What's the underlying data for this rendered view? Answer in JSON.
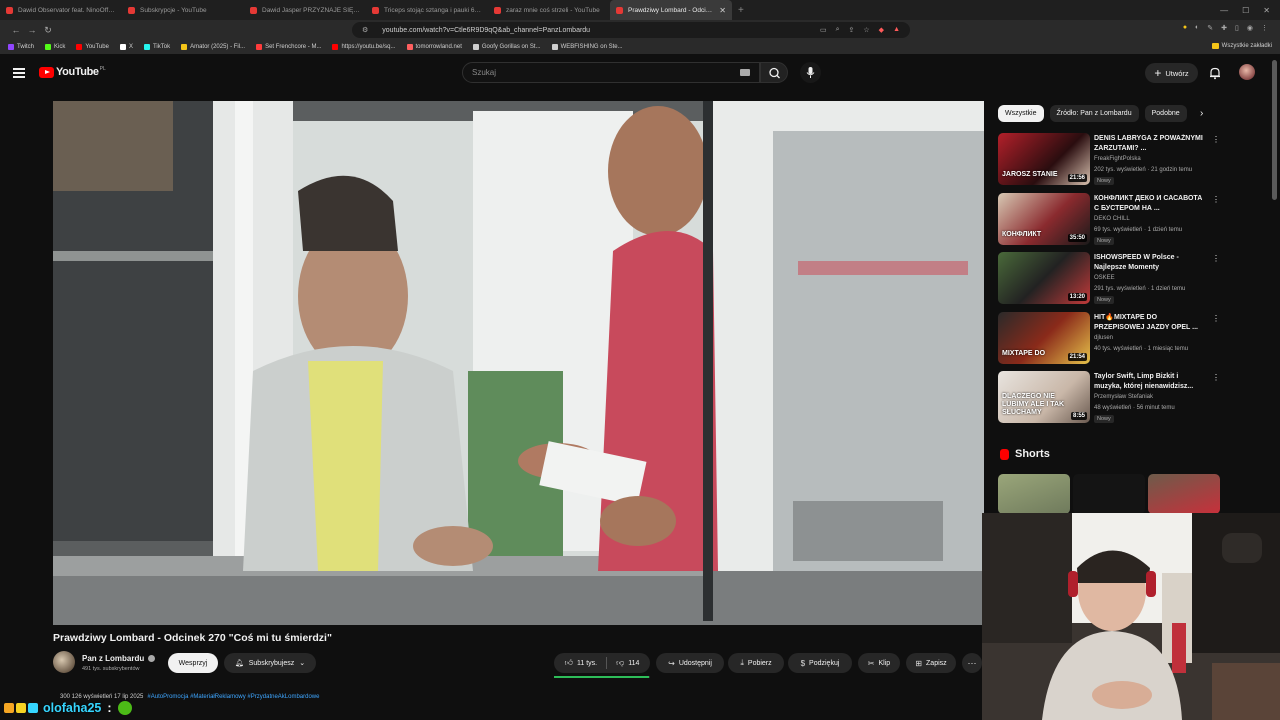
{
  "browser": {
    "tabs": [
      {
        "title": "Dawid Observator feat. NinoOfficjal",
        "active": false
      },
      {
        "title": "Subskrypcje - YouTube",
        "active": false
      },
      {
        "title": "Dawid Jasper PRZYZNAJE SIĘ DO B...",
        "active": false
      },
      {
        "title": "Triceps stojąc sztanga i pauki 6 x 3...",
        "active": false
      },
      {
        "title": "zaraz mnie coś strzeli - YouTube",
        "active": false
      },
      {
        "title": "Prawdziwy Lombard - Odcinek",
        "active": true
      }
    ],
    "url": "youtube.com/watch?v=Ctle6R9D9qQ&ab_channel=PanzLombardu",
    "bookmarks": [
      {
        "label": "Twitch",
        "color": "#9146ff"
      },
      {
        "label": "Kick",
        "color": "#53fc18"
      },
      {
        "label": "YouTube",
        "color": "#ff0000"
      },
      {
        "label": "X",
        "color": "#ffffff"
      },
      {
        "label": "TikTok",
        "color": "#25f4ee"
      },
      {
        "label": "Amator (2025) - Fil...",
        "color": "#f5c518"
      },
      {
        "label": "Set Frenchcore - M...",
        "color": "#ff3b3b"
      },
      {
        "label": "https://youtu.be/sq...",
        "color": "#ff0000"
      },
      {
        "label": "tomorrowland.net",
        "color": "#ff5f5f"
      },
      {
        "label": "Goofy Gorillas on St...",
        "color": "#cfcfcf"
      },
      {
        "label": "WEBFISHING on Ste...",
        "color": "#cfcfcf"
      }
    ],
    "bookmarks_all": "Wszystkie zakładki"
  },
  "header": {
    "logo_text": "YouTube",
    "logo_region": "PL",
    "search_placeholder": "Szukaj",
    "create_label": "Utwórz"
  },
  "video": {
    "title": "Prawdziwy Lombard - Odcinek 270 \"Coś mi tu śmierdzi\"",
    "channel": "Pan z Lombardu",
    "subscribers": "491 tys. subskrybentów",
    "support_label": "Wesprzyj",
    "subscribed_label": "Subskrybujesz",
    "likes": "11 tys.",
    "dislikes": "114",
    "like_ratio": 0.99,
    "share_label": "Udostępnij",
    "download_label": "Pobierz",
    "thanks_label": "Podziękuj",
    "clip_label": "Klip",
    "save_label": "Zapisz",
    "desc_peek": "300 126 wyświetleń  17 lip 2025",
    "desc_tags": "#AutoPromocja #MateriałReklamowy #PrzydatneAkLombardowe"
  },
  "sidebar": {
    "chips": [
      "Wszystkie",
      "Źródło: Pan z Lombardu",
      "Podobne"
    ],
    "recommendations": [
      {
        "title": "DENIS LABRYGA Z POWAŻNYMI ZARZUTAMI? ...",
        "channel": "FreakFightPolska",
        "meta": "202 tys. wyświetleń · 21 godzin temu",
        "badge": "Nowy",
        "duration": "21:56",
        "thumb_text": "JAROSZ  STANIE"
      },
      {
        "title": "КОНФЛИКТ ДЕКО И САСАВОТА С БУСТЕРОМ НА ...",
        "channel": "DEKO CHILL",
        "meta": "69 tys. wyświetleń · 1 dzień temu",
        "badge": "Nowy",
        "duration": "35:50",
        "thumb_text": "КОНФЛИКТ"
      },
      {
        "title": "ISHOWSPEED W Polsce - Najlepsze Momenty",
        "channel": "OSKEE",
        "meta": "291 tys. wyświetleń · 1 dzień temu",
        "badge": "Nowy",
        "duration": "13:20",
        "thumb_text": ""
      },
      {
        "title": "HIT🔥MIXTAPE DO PRZEPISOWEJ JAZDY OPEL ...",
        "channel": "djlusen",
        "meta": "40 tys. wyświetleń · 1 miesiąc temu",
        "badge": "",
        "duration": "21:54",
        "thumb_text": "MIXTAPE DO"
      },
      {
        "title": "Taylor Swift, Limp Bizkit i muzyka, której nienawidzisz...",
        "channel": "Przemysław Stefaniak",
        "meta": "48 wyświetleń · 56 minut temu",
        "badge": "Nowy",
        "duration": "8:55",
        "thumb_text": "DLACZEGO NIE LUBIMY ALE I TAK SŁUCHAMY"
      }
    ],
    "shorts_label": "Shorts"
  },
  "chat": {
    "username": "olofaha25",
    "colon": ":"
  },
  "colors": {
    "accent_red": "#ff0000",
    "like_bar": "#2ebd59",
    "chat_user": "#36d6ff"
  }
}
